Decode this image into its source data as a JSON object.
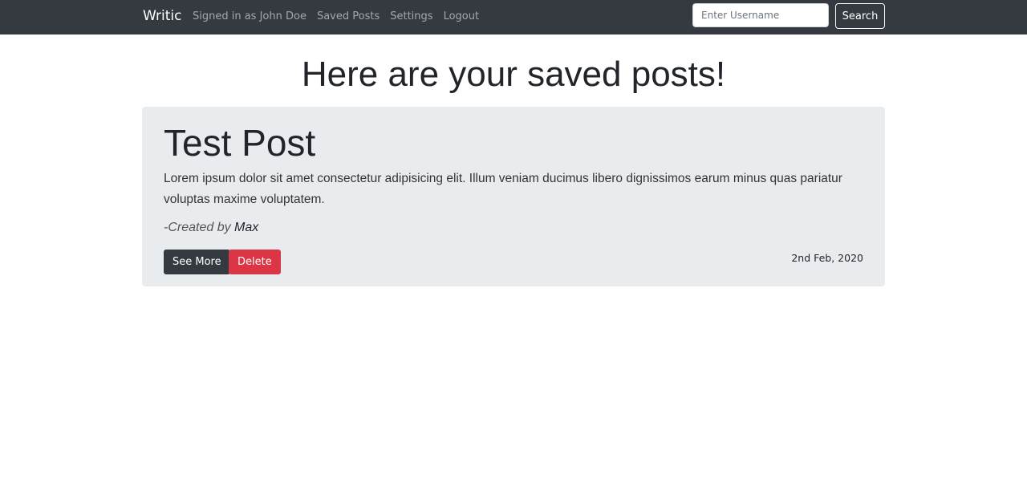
{
  "nav": {
    "brand": "Writic",
    "links": [
      "Signed in as John Doe",
      "Saved Posts",
      "Settings",
      "Logout"
    ],
    "search_placeholder": "Enter Username",
    "search_label": "Search"
  },
  "heading": "Here are your saved posts!",
  "posts": [
    {
      "title": "Test Post",
      "body": "Lorem ipsum dolor sit amet consectetur adipisicing elit. Illum veniam ducimus libero dignissimos earum minus quas pariatur voluptas maxime voluptatem.",
      "created_prefix": "-Created by ",
      "author": "Max",
      "see_more_label": "See More",
      "delete_label": "Delete",
      "date": "2nd Feb, 2020"
    }
  ],
  "colors": {
    "navbar": "#343a40",
    "card": "#e9ecef",
    "danger": "#dc3545"
  }
}
